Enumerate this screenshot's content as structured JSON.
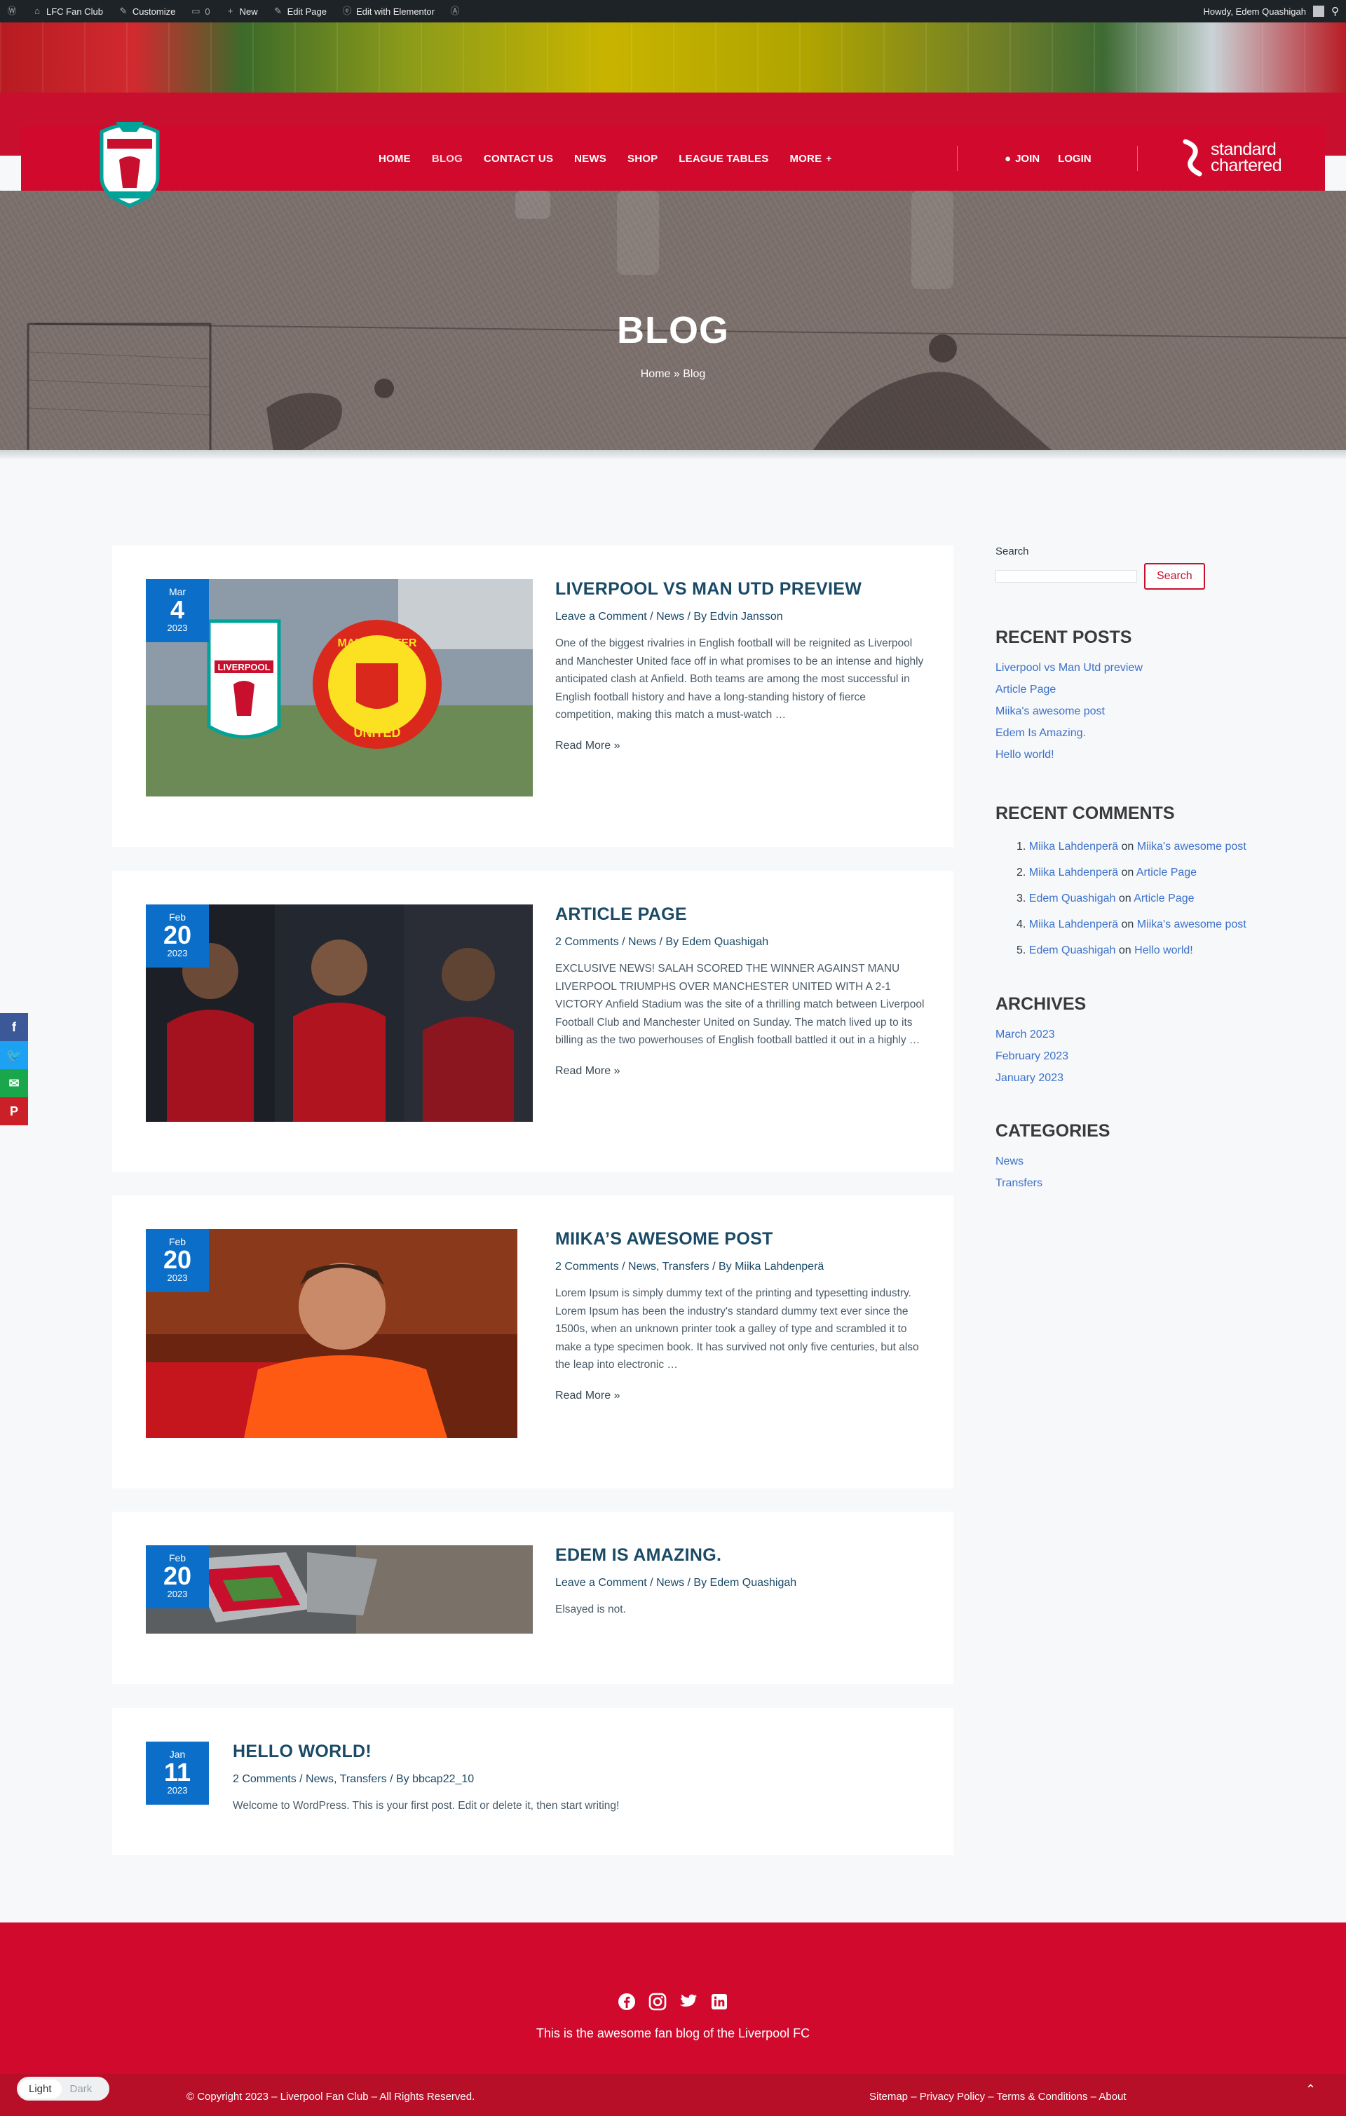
{
  "adminbar": {
    "site": "LFC Fan Club",
    "customize": "Customize",
    "comments": "0",
    "new": "New",
    "edit_page": "Edit Page",
    "elementor": "Edit with Elementor",
    "howdy": "Howdy, Edem Quashigah"
  },
  "nav": {
    "items": [
      "HOME",
      "BLOG",
      "CONTACT US",
      "NEWS",
      "SHOP",
      "LEAGUE TABLES",
      "MORE"
    ],
    "join": "JOIN",
    "login": "LOGIN"
  },
  "sponsor": {
    "line1": "standard",
    "line2": "chartered"
  },
  "hero": {
    "title": "BLOG",
    "breadcrumb": "Home » Blog"
  },
  "posts": [
    {
      "month": "Mar",
      "day": "4",
      "year": "2023",
      "title": "LIVERPOOL VS MAN UTD PREVIEW",
      "comments": "Leave a Comment",
      "categories": "News",
      "author": "Edvin Jansson",
      "excerpt": "One of the biggest rivalries in English football will be reignited as Liverpool and Manchester United face off in what promises to be an intense and highly anticipated clash at Anfield. Both teams are among the most successful in English football history and have a long-standing history of fierce competition, making this match a must-watch …",
      "read_more": "Read More »",
      "thumb_text_1": "LIVERPOOL",
      "thumb_text_2": "MANCHESTER",
      "thumb_text_3": "UNITED"
    },
    {
      "month": "Feb",
      "day": "20",
      "year": "2023",
      "title": "ARTICLE PAGE",
      "comments": "2 Comments",
      "categories": "News",
      "author": "Edem Quashigah",
      "excerpt": "EXCLUSIVE NEWS! SALAH SCORED THE WINNER AGAINST MANU LIVERPOOL TRIUMPHS OVER MANCHESTER UNITED WITH A 2-1 VICTORY Anfield Stadium was the site of a thrilling match between Liverpool Football Club and Manchester United on Sunday. The match lived up to its billing as the two powerhouses of English football battled it out in a highly …",
      "read_more": "Read More »"
    },
    {
      "month": "Feb",
      "day": "20",
      "year": "2023",
      "title": "MIIKA’S AWESOME POST",
      "comments": "2 Comments",
      "categories": "News, Transfers",
      "author": "Miika Lahdenperä",
      "excerpt": "Lorem Ipsum is simply dummy text of the printing and typesetting industry. Lorem Ipsum has been the industry's standard dummy text ever since the 1500s, when an unknown printer took a galley of type and scrambled it to make a type specimen book. It has survived not only five centuries, but also the leap into electronic …",
      "read_more": "Read More »"
    },
    {
      "month": "Feb",
      "day": "20",
      "year": "2023",
      "title": "EDEM IS AMAZING.",
      "comments": "Leave a Comment",
      "categories": "News",
      "author": "Edem Quashigah",
      "excerpt": "Elsayed is not."
    },
    {
      "month": "Jan",
      "day": "11",
      "year": "2023",
      "title": "HELLO WORLD!",
      "comments": "2 Comments",
      "categories": "News, Transfers",
      "author": "bbcap22_10",
      "excerpt": "Welcome to WordPress. This is your first post. Edit or delete it, then start writing!"
    }
  ],
  "sidebar": {
    "search_label": "Search",
    "search_button": "Search",
    "recent_posts_title": "RECENT POSTS",
    "recent_posts": [
      "Liverpool vs Man Utd preview",
      "Article Page",
      "Miika's awesome post",
      "Edem Is Amazing.",
      "Hello world!"
    ],
    "recent_comments_title": "RECENT COMMENTS",
    "recent_comments": [
      {
        "n": "1.",
        "author": "Miika Lahdenperä",
        "on": "on",
        "post": "Miika's awesome post"
      },
      {
        "n": "2.",
        "author": "Miika Lahdenperä",
        "on": "on",
        "post": "Article Page"
      },
      {
        "n": "3.",
        "author": "Edem Quashigah",
        "on": "on",
        "post": "Article Page"
      },
      {
        "n": "4.",
        "author": "Miika Lahdenperä",
        "on": "on",
        "post": "Miika's awesome post"
      },
      {
        "n": "5.",
        "author": "Edem Quashigah",
        "on": "on",
        "post": "Hello world!"
      }
    ],
    "archives_title": "ARCHIVES",
    "archives": [
      "March 2023",
      "February 2023",
      "January 2023"
    ],
    "categories_title": "CATEGORIES",
    "categories": [
      "News",
      "Transfers"
    ]
  },
  "footer": {
    "tagline": "This is the awesome fan blog of the Liverpool FC",
    "copyright": "© Copyright 2023 – Liverpool Fan Club – All Rights Reserved.",
    "links": "Sitemap – Privacy Policy – Terms & Conditions – About"
  },
  "theme_toggle": {
    "light": "Light",
    "dark": "Dark"
  },
  "colors": {
    "brand_red": "#d10a2d",
    "date_blue": "#0b6fc9",
    "link_blue": "#3d71c9"
  }
}
